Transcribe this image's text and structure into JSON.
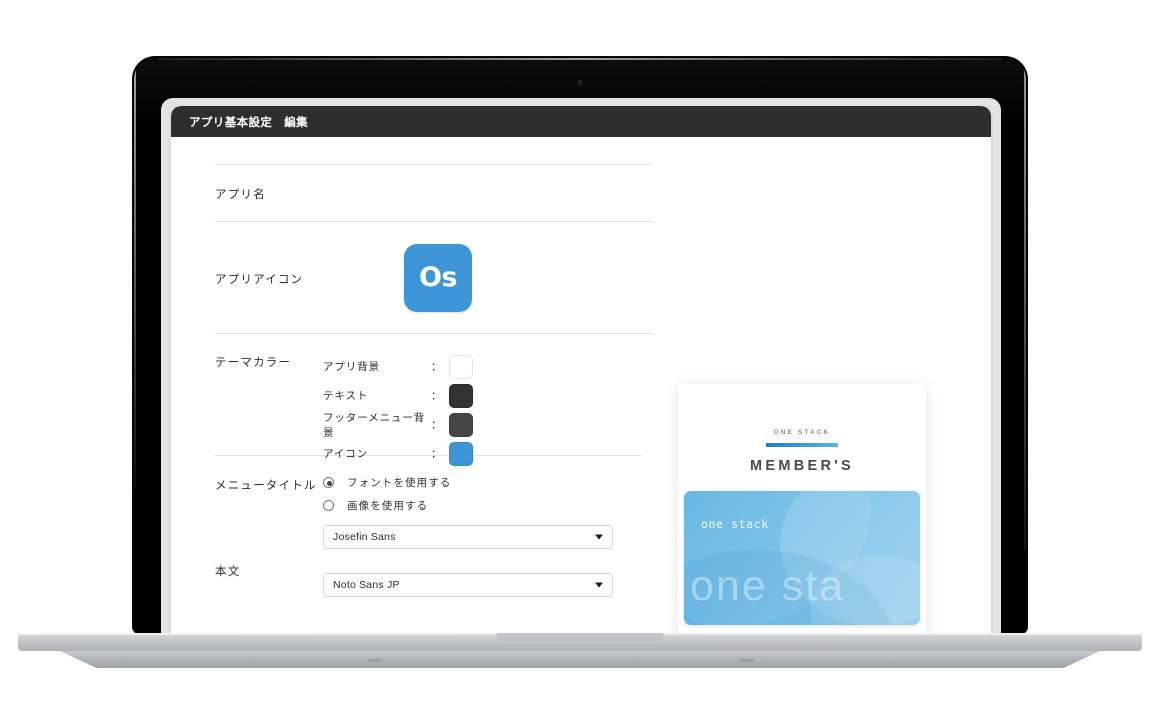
{
  "window": {
    "titlebar": "アプリ基本設定　編集"
  },
  "form": {
    "app_name": {
      "label": "アプリ名",
      "value": ""
    },
    "app_icon": {
      "label": "アプリアイコン",
      "glyph": "Os",
      "color": "#3d96d8"
    },
    "theme_color": {
      "label": "テーマカラー",
      "colon": "：",
      "items": [
        {
          "name": "アプリ背景",
          "color": "#ffffff"
        },
        {
          "name": "テキスト",
          "color": "#333333"
        },
        {
          "name": "フッターメニュー背景",
          "color": "#464646"
        },
        {
          "name": "アイコン",
          "color": "#3d96d8"
        }
      ]
    },
    "menu_title": {
      "label": "メニュータイトル",
      "options": [
        {
          "text": "フォントを使用する",
          "selected": true
        },
        {
          "text": "画像を使用する",
          "selected": false
        }
      ],
      "font_select": {
        "value": "Josefin Sans",
        "caret": "▼"
      }
    },
    "body_text": {
      "label": "本文",
      "font_select": {
        "value": "Noto Sans JP",
        "caret": "▼"
      }
    }
  },
  "preview": {
    "brand": "ONE STACK",
    "title": "MEMBER'S",
    "bar_gradient_from": "#1d7ec4",
    "bar_gradient_to": "#5fb4e8",
    "card": {
      "label": "one stack",
      "ghost_text": "one sta",
      "color_from": "#5bb2e0",
      "color_to": "#93cdee"
    }
  }
}
